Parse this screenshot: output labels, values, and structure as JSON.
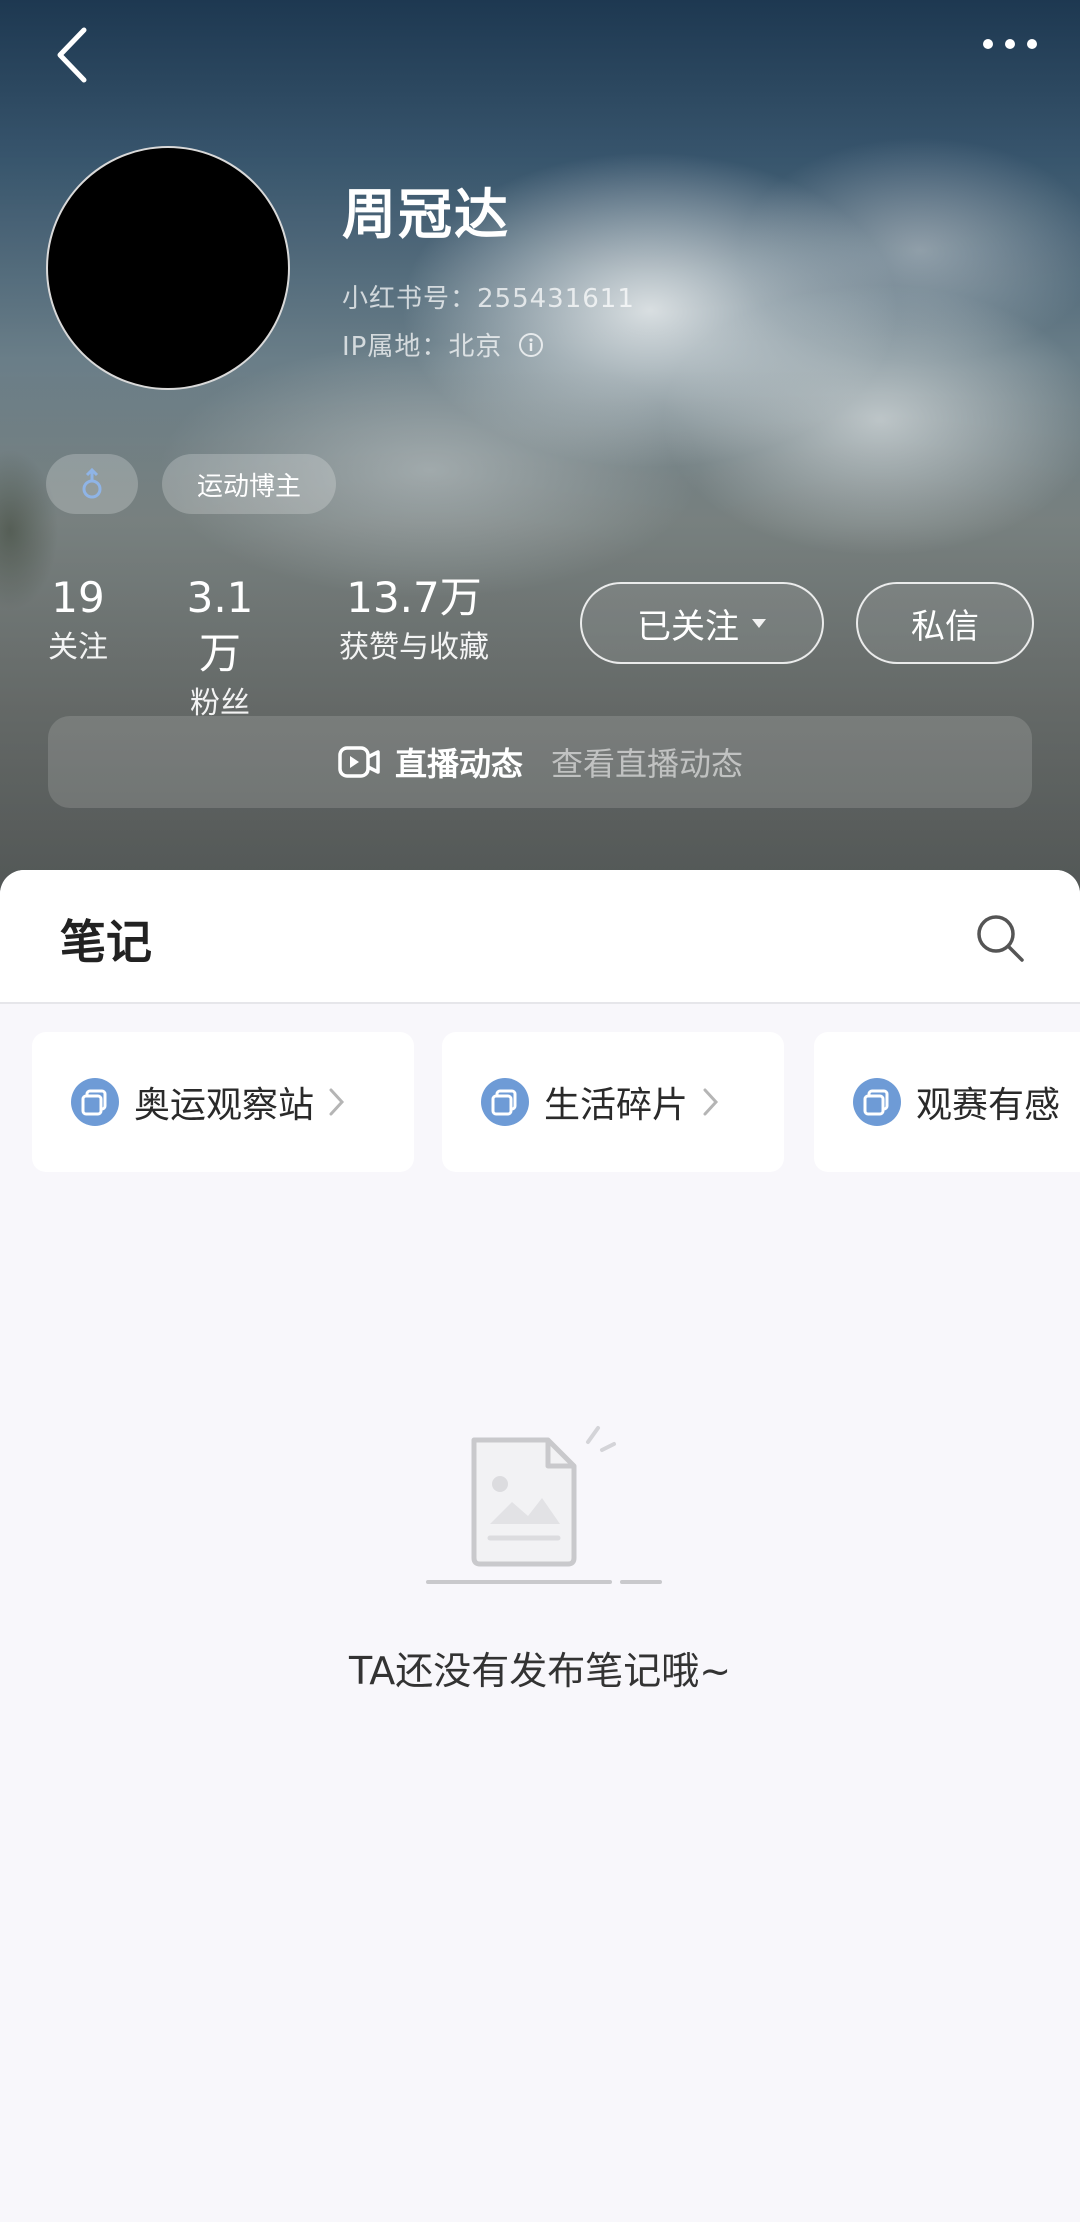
{
  "profile": {
    "name": "周冠达",
    "id_text": "小红书号：255431611",
    "ip_text": "IP属地：北京",
    "tags": {
      "role": "运动博主"
    }
  },
  "icons": {
    "back": "chevron-left-icon",
    "more": "more-dots-icon",
    "gender": "male-icon",
    "info": "info-icon",
    "live": "live-camera-icon",
    "search": "search-icon",
    "folder": "collection-icon",
    "chevron": "chevron-right-icon",
    "empty": "empty-document-icon"
  },
  "stats": {
    "following": {
      "value": "19",
      "label": "关注"
    },
    "fans": {
      "value": "3.1万",
      "label": "粉丝"
    },
    "likes": {
      "value": "13.7万",
      "label": "获赞与收藏"
    }
  },
  "actions": {
    "followed_label": "已关注",
    "message_label": "私信"
  },
  "live": {
    "title": "直播动态",
    "subtitle": "查看直播动态"
  },
  "notes": {
    "tab_label": "笔记",
    "collections": [
      {
        "label": "奥运观察站"
      },
      {
        "label": "生活碎片"
      },
      {
        "label": "观赛有感"
      }
    ],
    "empty_text": "TA还没有发布笔记哦~"
  },
  "colors": {
    "folder_icon": "#6e9bd6",
    "sheet_bg": "#f8f7fb"
  }
}
